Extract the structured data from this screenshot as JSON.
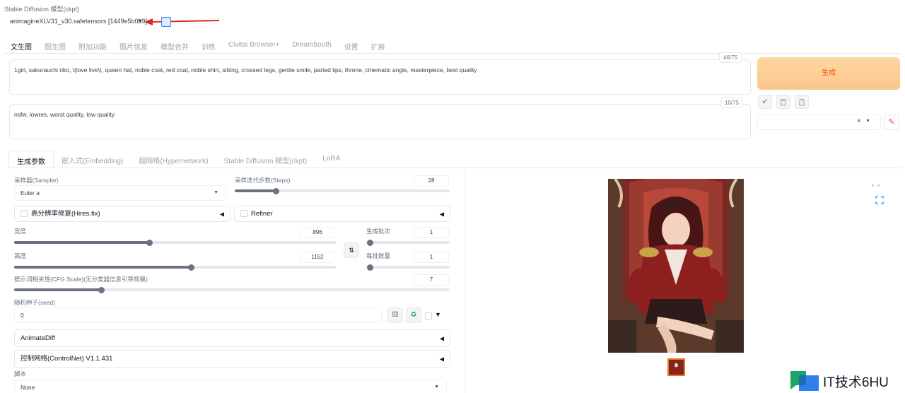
{
  "header": {
    "checkpoint_label": "Stable Diffusion 模型(ckpt)",
    "checkpoint_value": "animagineXLV31_v30.safetensors [1449e5b0b9]"
  },
  "tabs": [
    "文生图",
    "图生图",
    "附加功能",
    "图片信息",
    "模型合并",
    "训练",
    "Civitai Browser+",
    "Dreambooth",
    "设置",
    "扩展"
  ],
  "prompt": {
    "positive": "1girl, sakurauchi riko, \\(love live\\), queen hat, noble coat, red coat, noble shirt, sitting, crossed legs, gentle smile, parted lips, throne, cinematic angle, masterpiece, best quality",
    "positive_count": "46/75",
    "negative": "nsfw, lowres, worst quality, low quality",
    "negative_count": "10/75"
  },
  "generate": {
    "label": "生成"
  },
  "subtabs": [
    "生成参数",
    "嵌入式(Embedding)",
    "超网络(Hypernetwork)",
    "Stable Diffusion 模型(ckpt)",
    "LoRA"
  ],
  "params": {
    "sampler_label": "采样器(Sampler)",
    "sampler_value": "Euler a",
    "steps_label": "采样迭代步数(Steps)",
    "steps_value": "28",
    "steps_fraction": 0.19,
    "hires_label": "高分辨率修复(Hires.fix)",
    "refiner_label": "Refiner",
    "width_label": "宽度",
    "width_value": "896",
    "width_fraction": 0.42,
    "height_label": "高度",
    "height_value": "1152",
    "height_fraction": 0.55,
    "batch_count_label": "生成批次",
    "batch_count_value": "1",
    "batch_size_label": "每批数量",
    "batch_size_value": "1",
    "cfg_label": "提示词相关性(CFG Scale)(无分类器信息引导规模)",
    "cfg_value": "7",
    "cfg_fraction": 0.2,
    "seed_label": "随机种子(seed)",
    "seed_value": "0",
    "animatediff_label": "AnimateDiff",
    "controlnet_label": "控制网络(ControlNet) V1.1.431",
    "script_label": "脚本",
    "script_value": "None"
  },
  "watermark": {
    "text": "IT技术6HU"
  },
  "colors": {
    "accent_orange": "#f97316",
    "generate_bg": "#fbc78a",
    "arrow_red": "#dc2626"
  }
}
